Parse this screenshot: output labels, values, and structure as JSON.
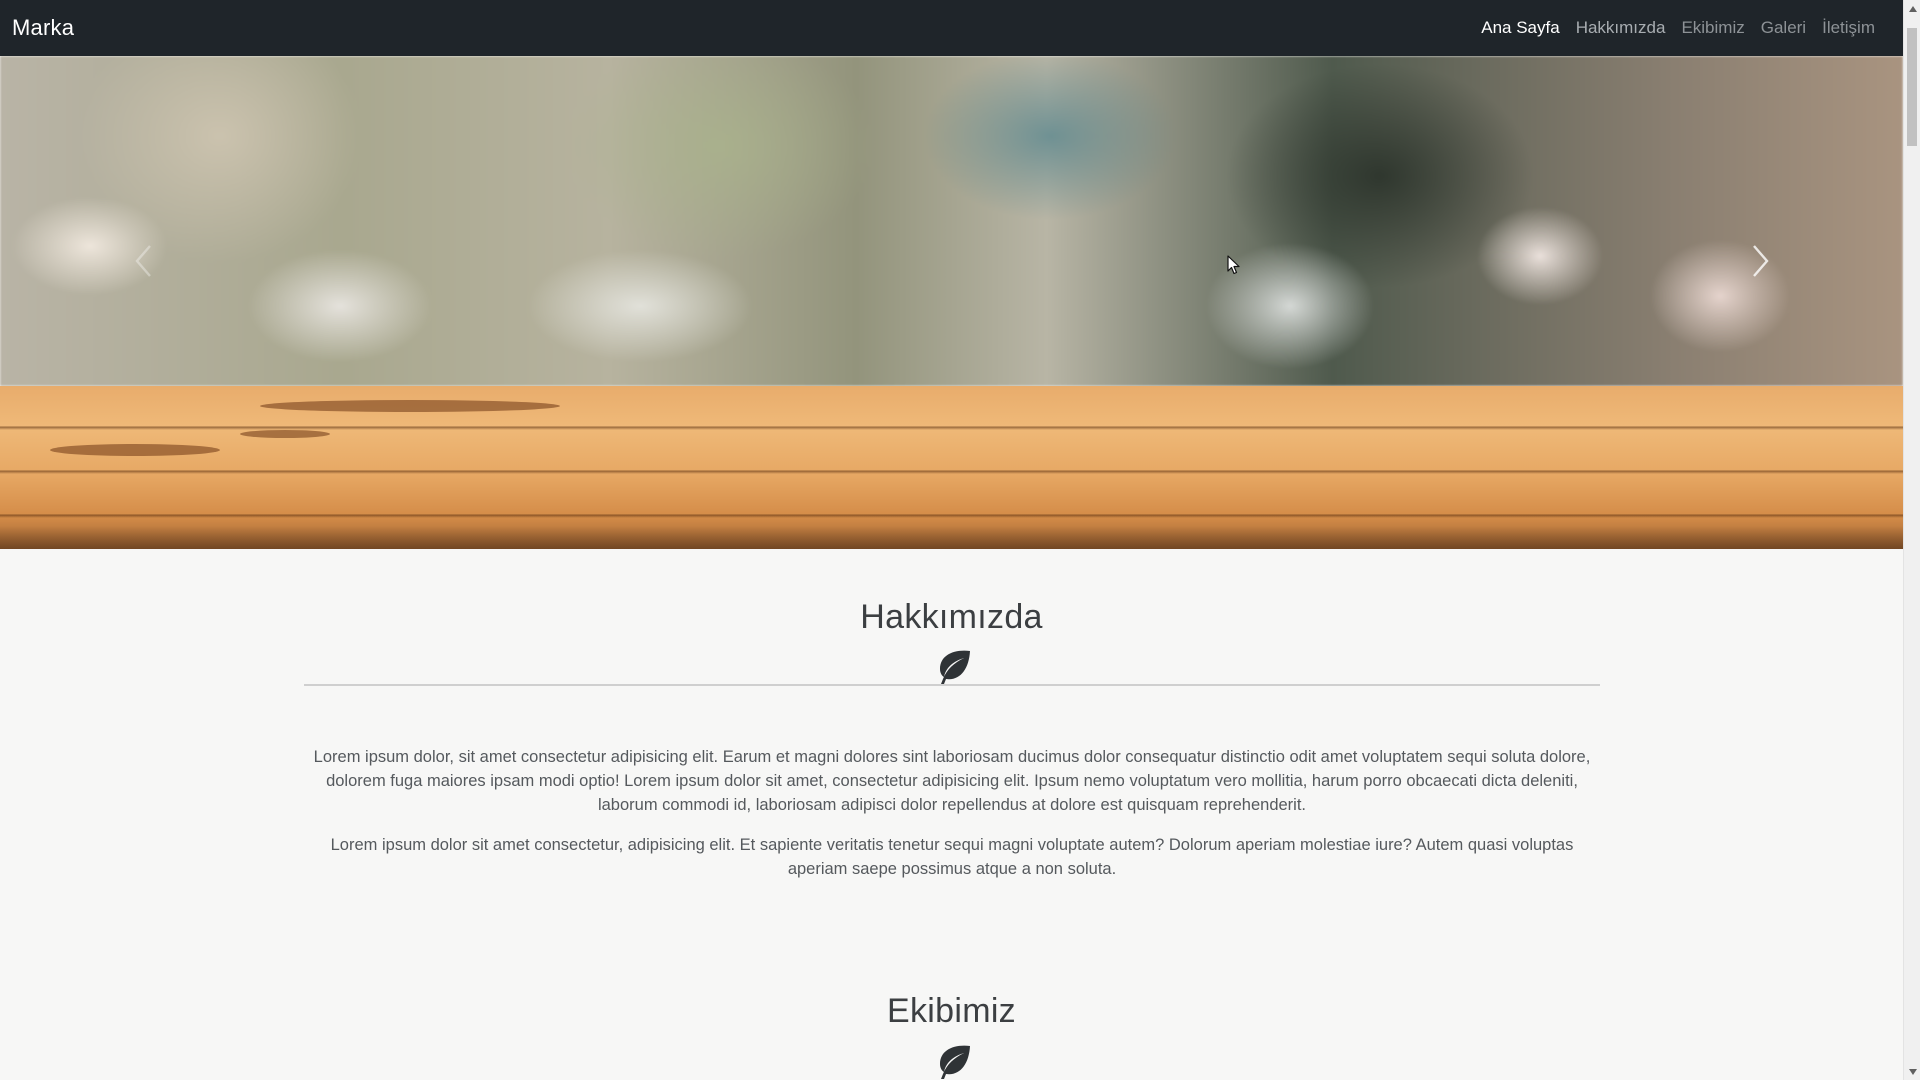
{
  "navbar": {
    "brand": "Marka",
    "links": [
      {
        "label": "Ana Sayfa",
        "active": true
      },
      {
        "label": "Hakkımızda",
        "active": false
      },
      {
        "label": "Ekibimiz",
        "active": false
      },
      {
        "label": "Galeri",
        "active": false
      },
      {
        "label": "İletişim",
        "active": false
      }
    ]
  },
  "hero": {
    "prev_icon": "chevron-left-icon",
    "next_icon": "chevron-right-icon"
  },
  "about": {
    "title": "Hakkımızda",
    "icon": "leaf-icon",
    "paragraphs": [
      "Lorem ipsum dolor, sit amet consectetur adipisicing elit. Earum et magni dolores sint laboriosam ducimus dolor consequatur distinctio odit amet voluptatem sequi soluta dolore, dolorem fuga maiores ipsam modi optio! Lorem ipsum dolor sit amet, consectetur adipisicing elit. Ipsum nemo voluptatum vero mollitia, harum porro obcaecati dicta deleniti, laborum commodi id, laboriosam adipisci dolor repellendus at dolore est quisquam reprehenderit.",
      "Lorem ipsum dolor sit amet consectetur, adipisicing elit. Et sapiente veritatis tenetur sequi magni voluptate autem? Dolorum aperiam molestiae iure? Autem quasi voluptas aperiam saepe possimus atque a non soluta."
    ]
  },
  "team": {
    "title": "Ekibimiz",
    "icon": "leaf-icon"
  },
  "colors": {
    "navbar_bg": "#1f252a",
    "page_bg": "#f7f7f6",
    "heading": "#3c3f42",
    "body_text": "#55595d",
    "leaf": "#2f3336"
  }
}
